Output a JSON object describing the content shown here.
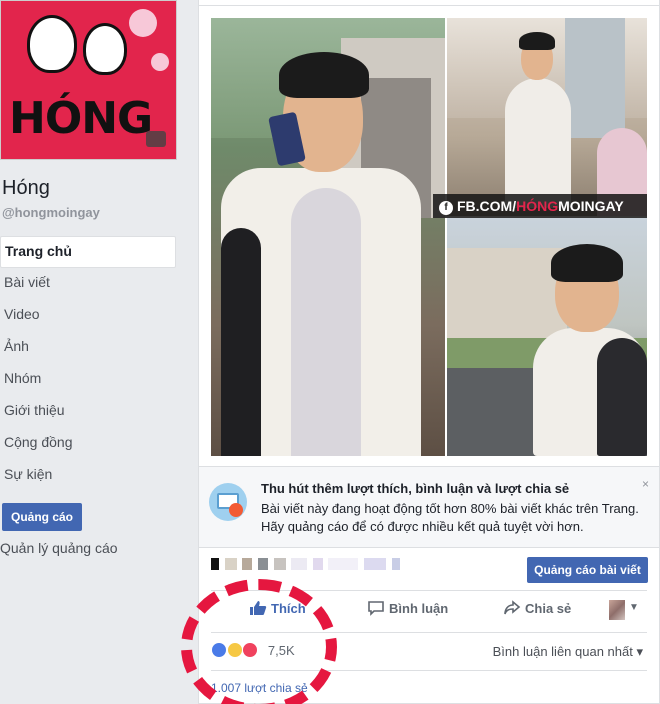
{
  "page": {
    "name": "Hóng",
    "handle": "@hongmoingay",
    "avatar_text": "HÓNG"
  },
  "sidebar": {
    "items": [
      {
        "label": "Trang chủ",
        "active": true
      },
      {
        "label": "Bài viết"
      },
      {
        "label": "Video"
      },
      {
        "label": "Ảnh"
      },
      {
        "label": "Nhóm"
      },
      {
        "label": "Giới thiệu"
      },
      {
        "label": "Cộng đồng"
      },
      {
        "label": "Sự kiện"
      }
    ],
    "ad_button": "Quảng cáo",
    "ad_manage": "Quản lý quảng cáo"
  },
  "post": {
    "watermark_prefix": "FB.COM/",
    "watermark_accent": "HÓNG",
    "watermark_suffix": "MOINGAY",
    "boost": {
      "title": "Thu hút thêm lượt thích, bình luận và lượt chia sẻ",
      "line1": "Bài viết này đang hoạt động tốt hơn 80% bài viết khác trên Trang.",
      "line2": "Hãy quảng cáo để có được nhiều kết quả tuyệt vời hơn.",
      "close": "×"
    },
    "boost_post_button": "Quảng cáo bài viết",
    "actions": {
      "like": "Thích",
      "comment": "Bình luận",
      "share": "Chia sẻ"
    },
    "reaction_count": "7,5K",
    "sort_label": "Bình luận liên quan nhất ▾",
    "shares": "1.007 lượt chia sẻ"
  },
  "colors": {
    "facebook_blue": "#4267b2",
    "highlight_red": "#e5173f",
    "brand_pink": "#e2254c"
  }
}
